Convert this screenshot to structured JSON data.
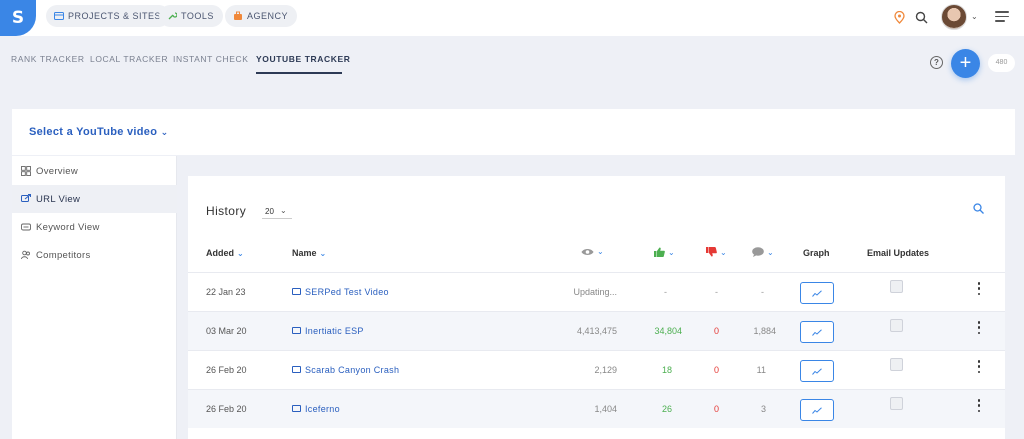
{
  "topbar": {
    "logo": "S",
    "nav": [
      {
        "label": "PROJECTS & SITES",
        "icon": "grid-icon"
      },
      {
        "label": "TOOLS",
        "icon": "tools-icon"
      },
      {
        "label": "AGENCY",
        "icon": "agency-icon"
      }
    ]
  },
  "tabs": [
    {
      "label": "RANK TRACKER",
      "active": false
    },
    {
      "label": "LOCAL TRACKER",
      "active": false
    },
    {
      "label": "INSTANT CHECK",
      "active": false
    },
    {
      "label": "YOUTUBE TRACKER",
      "active": true
    }
  ],
  "header": {
    "help": "?",
    "add": "+",
    "credits": "480"
  },
  "select_video": {
    "label": "Select a YouTube video"
  },
  "sidebar": {
    "items": [
      {
        "label": "Overview",
        "icon": "overview-icon",
        "active": false
      },
      {
        "label": "URL View",
        "icon": "link-icon",
        "active": true
      },
      {
        "label": "Keyword View",
        "icon": "keyword-icon",
        "active": false
      },
      {
        "label": "Competitors",
        "icon": "users-icon",
        "active": false
      }
    ]
  },
  "history": {
    "title": "History",
    "page_size": "20",
    "columns": {
      "added": "Added",
      "name": "Name",
      "graph": "Graph",
      "email": "Email Updates"
    },
    "rows": [
      {
        "added": "22 Jan 23",
        "name": "SERPed Test Video",
        "views": "Updating...",
        "likes": "-",
        "dislikes": "-",
        "comments": "-"
      },
      {
        "added": "03 Mar 20",
        "name": "Inertiatic ESP",
        "views": "4,413,475",
        "likes": "34,804",
        "dislikes": "0",
        "comments": "1,884"
      },
      {
        "added": "26 Feb 20",
        "name": "Scarab Canyon Crash",
        "views": "2,129",
        "likes": "18",
        "dislikes": "0",
        "comments": "11"
      },
      {
        "added": "26 Feb 20",
        "name": "Iceferno",
        "views": "1,404",
        "likes": "26",
        "dislikes": "0",
        "comments": "3"
      }
    ]
  },
  "colors": {
    "accent": "#3a86e6",
    "likes": "#4caf50",
    "dislikes": "#e53935",
    "pin": "#f0883a"
  }
}
